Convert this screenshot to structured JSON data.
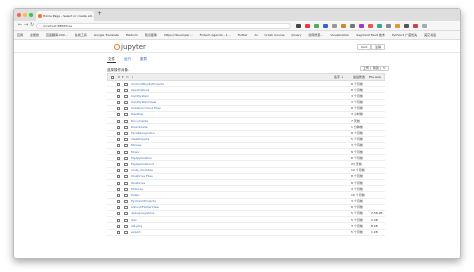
{
  "browser": {
    "tab_title": "Home Page - Select or create a …",
    "url": "localhost:8888/tree",
    "bookmarks": [
      "应用",
      "全能搜",
      "百度翻译-200…",
      "在线工具",
      "Google Translate",
      "Medium",
      "知识星球",
      "https://developer…",
      "Fintech Agenda - 1…",
      "Flutter",
      "AI",
      "Crash Course",
      "jQuery",
      "如何修复…",
      "Visualization",
      "Segment Fault 技术",
      "Python3 广度优先",
      "其它书签"
    ]
  },
  "jupyter": {
    "logo": "jupyter",
    "logout": "Quit",
    "logout2": "注销",
    "tabs": [
      "文件",
      "运行",
      "集群"
    ],
    "hint": "选择操作对象.",
    "upload_label": "上传",
    "new_label": "新建 ▾",
    "header": {
      "select_count": "0",
      "root": "/",
      "name_col": "名字 ↓",
      "modified_col": "最后修改",
      "size_col": "File size"
    },
    "files": [
      {
        "name": "AndroidStudioProjects",
        "modified": "8 个月前",
        "size": ""
      },
      {
        "name": "Applications",
        "modified": "8 个月前",
        "size": ""
      },
      {
        "name": "CardSystem",
        "modified": "3 个月前",
        "size": ""
      },
      {
        "name": "CardSystemView",
        "modified": "3 个月前",
        "size": ""
      },
      {
        "name": "Creative Cloud Files",
        "modified": "8 个月前",
        "size": ""
      },
      {
        "name": "Desktop",
        "modified": "3 小时前",
        "size": ""
      },
      {
        "name": "Documents",
        "modified": "7 天前",
        "size": ""
      },
      {
        "name": "Downloads",
        "modified": "1 分钟前",
        "size": ""
      },
      {
        "name": "FaceRecogniton",
        "modified": "8 个月前",
        "size": ""
      },
      {
        "name": "IdeaProjects",
        "modified": "5 个月前",
        "size": ""
      },
      {
        "name": "Movies",
        "modified": "3 个月前",
        "size": ""
      },
      {
        "name": "Music",
        "modified": "8 个月前",
        "size": ""
      },
      {
        "name": "MyApplication",
        "modified": "8 个月前",
        "size": ""
      },
      {
        "name": "MyApplication2",
        "modified": "23 天前",
        "size": ""
      },
      {
        "name": "node_modules",
        "modified": "10 个月前",
        "size": ""
      },
      {
        "name": "OneDrive Files",
        "modified": "8 个月前",
        "size": ""
      },
      {
        "name": "OneDrive",
        "modified": "8 个月前",
        "size": ""
      },
      {
        "name": "Pictures",
        "modified": "3 个月前",
        "size": ""
      },
      {
        "name": "Public",
        "modified": "10 个月前",
        "size": ""
      },
      {
        "name": "PycharmProjects",
        "modified": "3 个月前",
        "size": ""
      },
      {
        "name": "sohuxhFlutterView",
        "modified": "8 个月前",
        "size": ""
      },
      {
        "name": "debug.keystore",
        "modified": "5 个月前",
        "size": "2.58 kB"
      },
      {
        "name": "ipsc",
        "modified": "5 个月前",
        "size": "2 kB"
      },
      {
        "name": "jdk-pkg",
        "modified": "3 个月前",
        "size": "8 kB"
      },
      {
        "name": "export",
        "modified": "5 个月前",
        "size": "1 kB"
      }
    ]
  },
  "colors": {
    "accent": "#f37726",
    "link": "#3d6fb0"
  }
}
